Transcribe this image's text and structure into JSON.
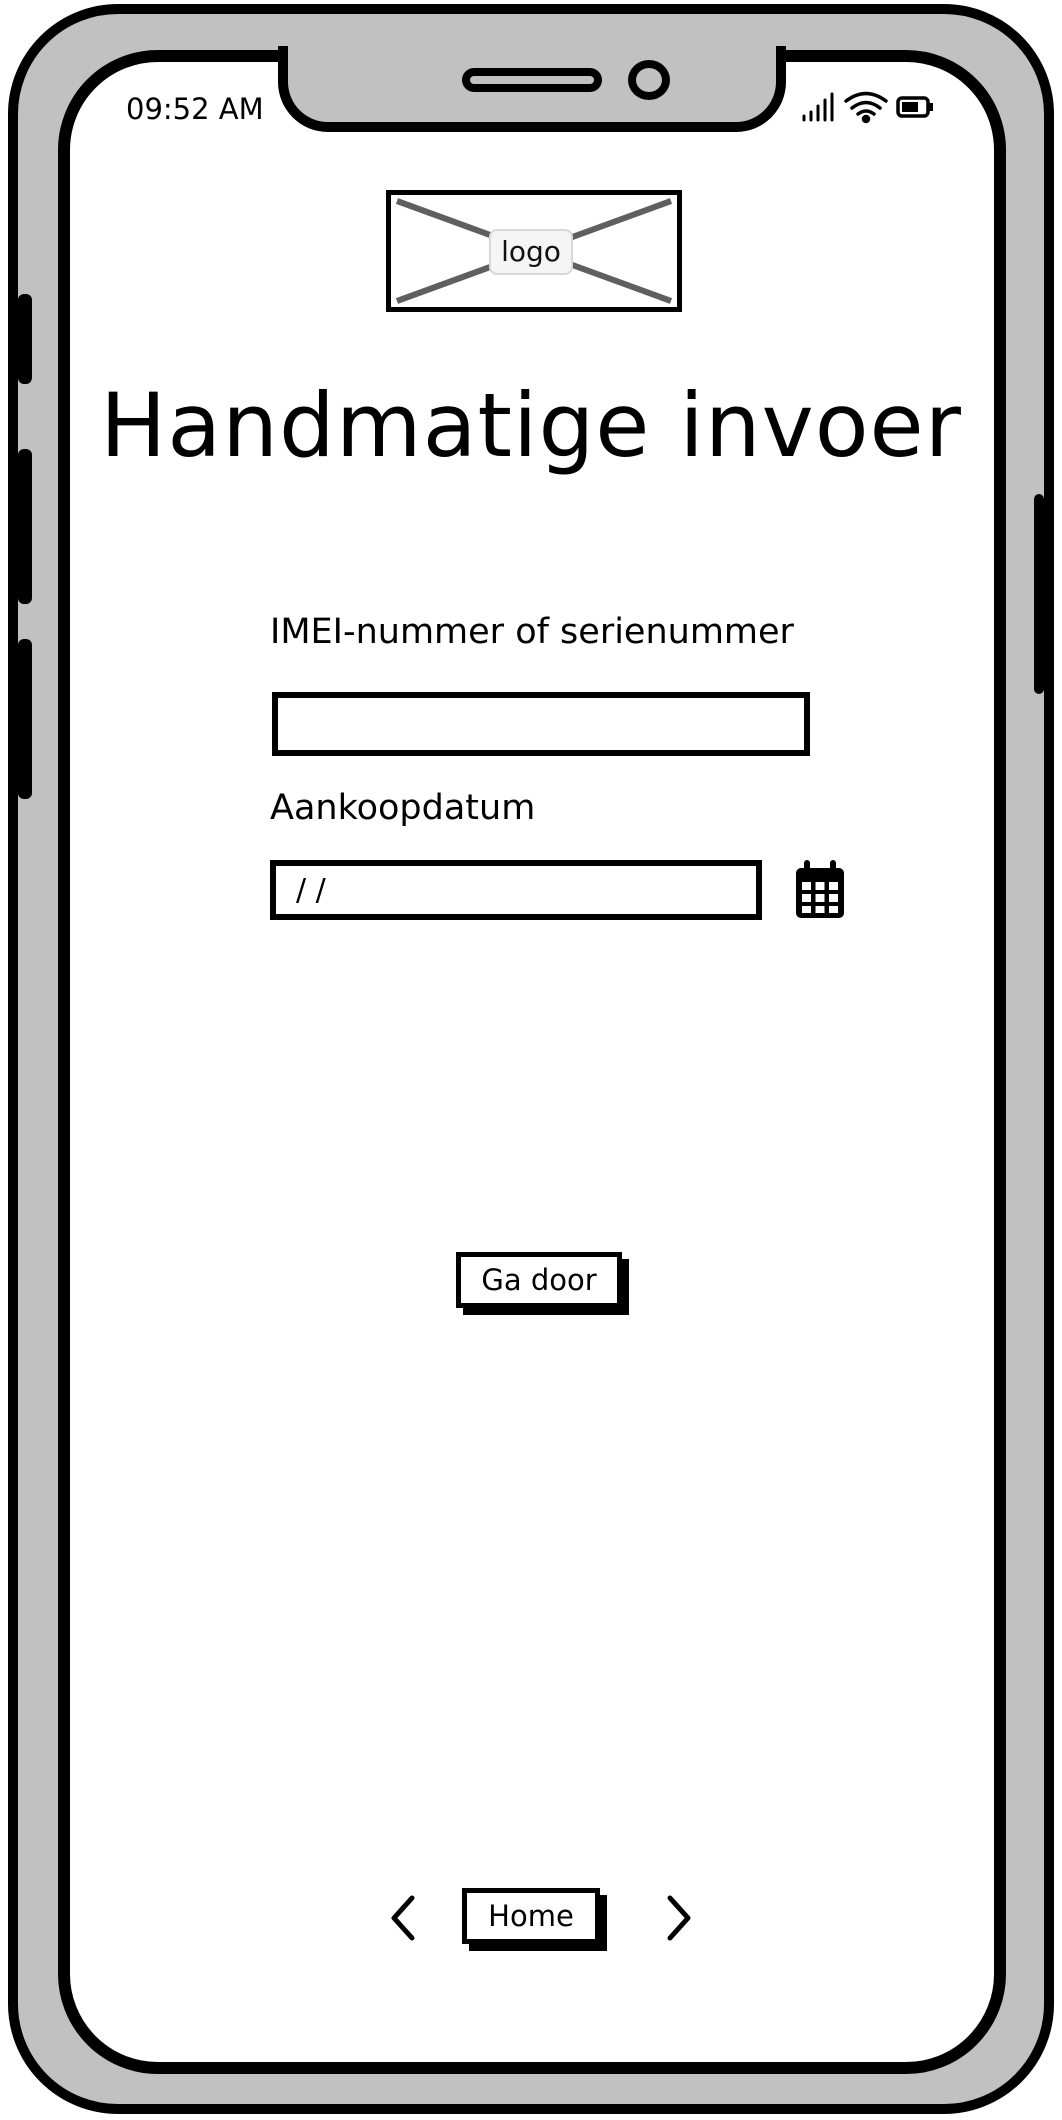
{
  "status_bar": {
    "time": "09:52 AM",
    "signal_icon": "signal-bars-icon",
    "wifi_icon": "wifi-icon",
    "battery_icon": "battery-icon"
  },
  "logo": {
    "label": "logo"
  },
  "page": {
    "title": "Handmatige invoer"
  },
  "form": {
    "imei_label": "IMEI-nummer of serienummer",
    "imei_value": "",
    "date_label": "Aankoopdatum",
    "date_placeholder": "/ /",
    "calendar_icon": "calendar-icon",
    "continue_label": "Ga door"
  },
  "bottom_nav": {
    "prev_icon": "chevron-left-icon",
    "home_label": "Home",
    "next_icon": "chevron-right-icon"
  }
}
